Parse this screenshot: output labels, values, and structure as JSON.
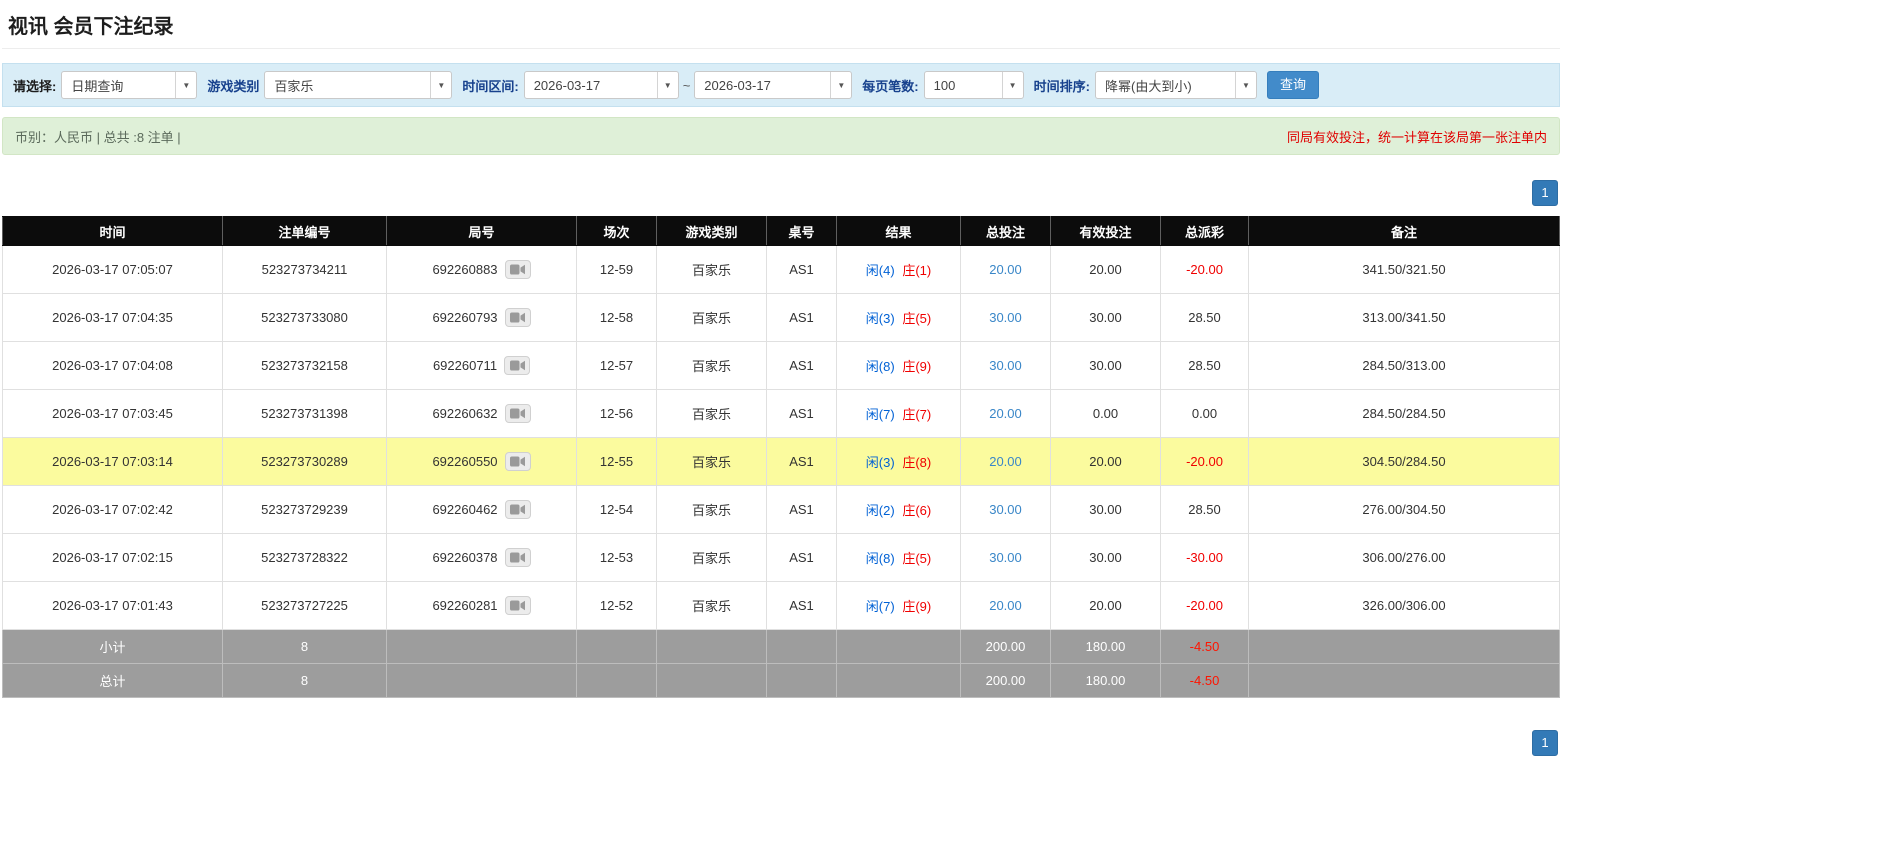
{
  "page": {
    "title": "视讯 会员下注纪录"
  },
  "filters": {
    "select_label": "请选择:",
    "select_value": "日期查询",
    "game_type_label": "游戏类别",
    "game_type_value": "百家乐",
    "range_label": "时间区间:",
    "date_from": "2026-03-17",
    "range_separator": "~",
    "date_to": "2026-03-17",
    "page_size_label": "每页笔数:",
    "page_size_value": "100",
    "sort_label": "时间排序:",
    "sort_value": "降幂(由大到小)",
    "search_button": "查询",
    "dropdown_arrow_icon": "▼"
  },
  "info_bar": {
    "summary": "币别：人民币 | 总共 :8 注单 |",
    "notice": "同局有效投注，统一计算在该局第一张注单内"
  },
  "pagination": {
    "current_page": "1"
  },
  "table": {
    "headers": [
      "时间",
      "注单编号",
      "局号",
      "场次",
      "游戏类别",
      "桌号",
      "结果",
      "总投注",
      "有效投注",
      "总派彩",
      "备注"
    ],
    "rows": [
      {
        "time": "2026-03-17 07:05:07",
        "bet_id": "523273734211",
        "round_id": "692260883",
        "session": "12-59",
        "game_type": "百家乐",
        "table_no": "AS1",
        "result_player": "闲(4)",
        "result_banker": "庄(1)",
        "total_bet": "20.00",
        "valid_bet": "20.00",
        "payout": "-20.00",
        "remark": "341.50/321.50",
        "highlighted": false
      },
      {
        "time": "2026-03-17 07:04:35",
        "bet_id": "523273733080",
        "round_id": "692260793",
        "session": "12-58",
        "game_type": "百家乐",
        "table_no": "AS1",
        "result_player": "闲(3)",
        "result_banker": "庄(5)",
        "total_bet": "30.00",
        "valid_bet": "30.00",
        "payout": "28.50",
        "remark": "313.00/341.50",
        "highlighted": false
      },
      {
        "time": "2026-03-17 07:04:08",
        "bet_id": "523273732158",
        "round_id": "692260711",
        "session": "12-57",
        "game_type": "百家乐",
        "table_no": "AS1",
        "result_player": "闲(8)",
        "result_banker": "庄(9)",
        "total_bet": "30.00",
        "valid_bet": "30.00",
        "payout": "28.50",
        "remark": "284.50/313.00",
        "highlighted": false
      },
      {
        "time": "2026-03-17 07:03:45",
        "bet_id": "523273731398",
        "round_id": "692260632",
        "session": "12-56",
        "game_type": "百家乐",
        "table_no": "AS1",
        "result_player": "闲(7)",
        "result_banker": "庄(7)",
        "total_bet": "20.00",
        "valid_bet": "0.00",
        "payout": "0.00",
        "remark": "284.50/284.50",
        "highlighted": false
      },
      {
        "time": "2026-03-17 07:03:14",
        "bet_id": "523273730289",
        "round_id": "692260550",
        "session": "12-55",
        "game_type": "百家乐",
        "table_no": "AS1",
        "result_player": "闲(3)",
        "result_banker": "庄(8)",
        "total_bet": "20.00",
        "valid_bet": "20.00",
        "payout": "-20.00",
        "remark": "304.50/284.50",
        "highlighted": true
      },
      {
        "time": "2026-03-17 07:02:42",
        "bet_id": "523273729239",
        "round_id": "692260462",
        "session": "12-54",
        "game_type": "百家乐",
        "table_no": "AS1",
        "result_player": "闲(2)",
        "result_banker": "庄(6)",
        "total_bet": "30.00",
        "valid_bet": "30.00",
        "payout": "28.50",
        "remark": "276.00/304.50",
        "highlighted": false
      },
      {
        "time": "2026-03-17 07:02:15",
        "bet_id": "523273728322",
        "round_id": "692260378",
        "session": "12-53",
        "game_type": "百家乐",
        "table_no": "AS1",
        "result_player": "闲(8)",
        "result_banker": "庄(5)",
        "total_bet": "30.00",
        "valid_bet": "30.00",
        "payout": "-30.00",
        "remark": "306.00/276.00",
        "highlighted": false
      },
      {
        "time": "2026-03-17 07:01:43",
        "bet_id": "523273727225",
        "round_id": "692260281",
        "session": "12-52",
        "game_type": "百家乐",
        "table_no": "AS1",
        "result_player": "闲(7)",
        "result_banker": "庄(9)",
        "total_bet": "20.00",
        "valid_bet": "20.00",
        "payout": "-20.00",
        "remark": "326.00/306.00",
        "highlighted": false
      }
    ],
    "summary_rows": [
      {
        "label": "小计",
        "count": "8",
        "total_bet": "200.00",
        "valid_bet": "180.00",
        "payout": "-4.50"
      },
      {
        "label": "总计",
        "count": "8",
        "total_bet": "200.00",
        "valid_bet": "180.00",
        "payout": "-4.50"
      }
    ]
  },
  "icons": {
    "video_replay": "video-camera",
    "dropdown": "chevron-down"
  },
  "colors": {
    "accent_blue": "#428bca",
    "pagination_blue": "#337ab7",
    "negative_red": "#f00000",
    "player_blue": "#0061d5",
    "banker_red": "#f00000",
    "highlight_yellow": "#fbfb9e",
    "header_black": "#0c0c0c",
    "filter_bg": "#d9edf7",
    "info_bg": "#dff0d8",
    "summary_gray": "#9d9d9d"
  }
}
